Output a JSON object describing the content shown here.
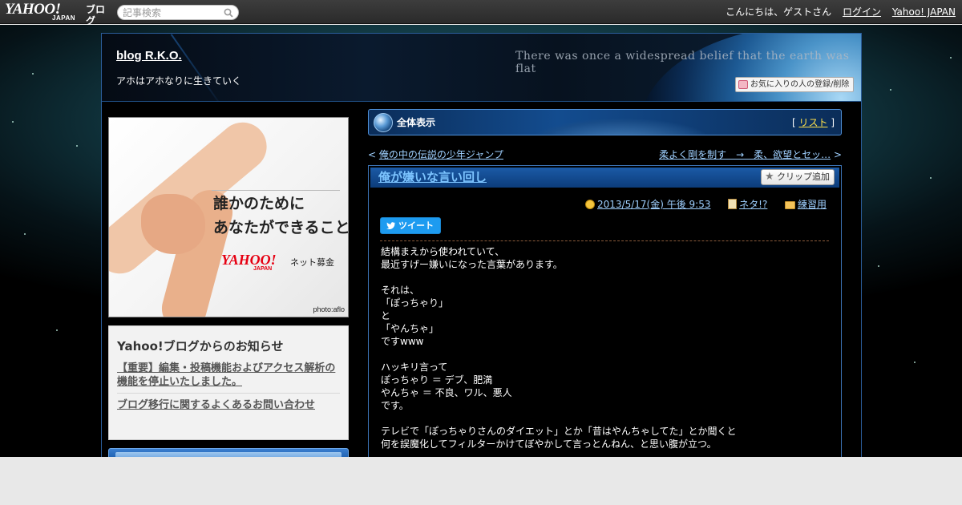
{
  "topbar": {
    "logo_main": "YAHOO!",
    "logo_sub": "JAPAN",
    "logo_blog": "ブログ",
    "search_placeholder": "記事検索",
    "greeting": "こんにちは、ゲストさん",
    "login": "ログイン",
    "yahoo_japan": "Yahoo! JAPAN"
  },
  "header": {
    "blog_title": "blog R.K.O.",
    "description": "アホはアホなりに生きていく",
    "banner_text": "There was once a widespread belief that the earth was flat",
    "favorite_button": "お気に入りの人の登録/削除"
  },
  "sidebar": {
    "ad": {
      "line1": "誰かのために",
      "line2": "あなたができること",
      "brand": "YAHOO!",
      "brand_sub": "JAPAN",
      "service": "ネット募金",
      "credit": "photo:aflo"
    },
    "notice": {
      "title": "Yahoo!ブログからのお知らせ",
      "links": [
        "【重要】編集・投稿機能およびアクセス解析の機能を停止いたしました。",
        "ブログ移行に関するよくあるお問い合わせ"
      ]
    }
  },
  "viewbar": {
    "label": "全体表示",
    "list_open": "[ ",
    "list_label": "リスト",
    "list_close": " ]"
  },
  "pager": {
    "prev_arrow": "< ",
    "prev": "俺の中の伝説の少年ジャンプ",
    "next": "柔よく剛を制す　→　柔、欲望とセッ…",
    "next_arrow": " >"
  },
  "article": {
    "title": "俺が嫌いな言い回し",
    "clip_button": "クリップ追加",
    "date": "2013/5/17(金) 午後 9:53",
    "category": "ネタ!?",
    "folder": "練習用",
    "tweet_button": "ツイート",
    "body": "結構まえから使われていて、\n最近すげー嫌いになった言葉があります。\n\nそれは、\n「ぽっちゃり」\nと\n「やんちゃ」\nですwww\n\nハッキリ言って\nぽっちゃり ＝ デブ、肥満\nやんちゃ ＝ 不良、ワル、悪人\nです。\n\nテレビで「ぽっちゃりさんのダイエット」とか「昔はやんちゃしてた」とか聞くと\n何を誤魔化してフィルターかけてぼやかして言っとんねん、と思い腹が立つ。"
  },
  "colors": {
    "link": "#9fd0ff",
    "accent_blue": "#1b5aa6",
    "list_link": "#ffe14a",
    "tweet": "#1d9bf0"
  }
}
